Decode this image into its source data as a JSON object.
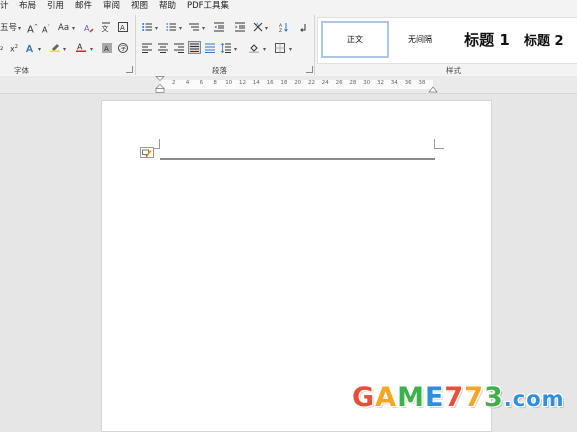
{
  "menu": {
    "items": [
      "计",
      "布局",
      "引用",
      "邮件",
      "审阅",
      "视图",
      "帮助",
      "PDF工具集"
    ]
  },
  "ribbon": {
    "font_size_value": "五号",
    "grow_font": "A",
    "shrink_font": "A",
    "case_label": "Aa",
    "superscript_label": "x",
    "groups": {
      "font": "字体",
      "paragraph": "段落",
      "styles": "样式"
    },
    "styles": [
      {
        "label": "正文"
      },
      {
        "label": "无间隔"
      },
      {
        "label": "标题 1"
      },
      {
        "label": "标题 2"
      }
    ],
    "colors": {
      "highlight": "#f5e400",
      "font_color": "#e0201c",
      "accent": "#2b579a",
      "selected_style_border": "#aec6e6"
    }
  },
  "ruler": {
    "ticks": [
      "2",
      "4",
      "6",
      "8",
      "10",
      "12",
      "14",
      "16",
      "18",
      "20",
      "22",
      "24",
      "26",
      "28",
      "30",
      "32",
      "34",
      "36",
      "38"
    ]
  },
  "watermark": {
    "letters": [
      "G",
      "A",
      "M",
      "E",
      "7",
      "7",
      "3",
      ".com"
    ],
    "colors": [
      "#e94e3c",
      "#f6a623",
      "#3db24b",
      "#2e8ee0",
      "#e94e3c",
      "#f6a623",
      "#3db24b",
      "#2e8ee0"
    ]
  }
}
